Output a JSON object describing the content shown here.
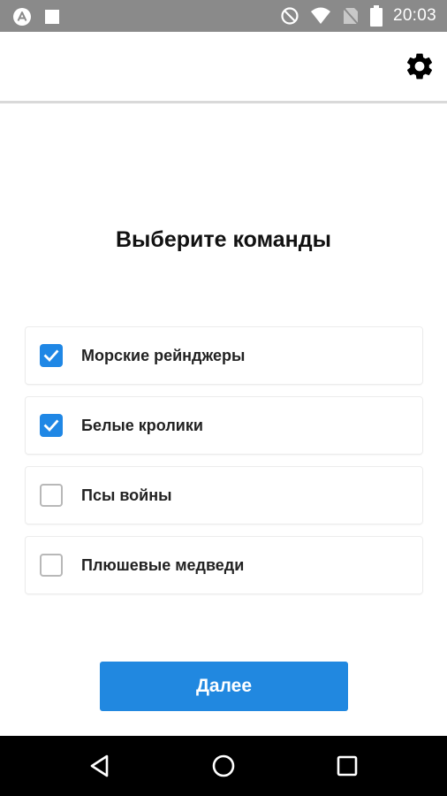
{
  "status_bar": {
    "time": "20:03",
    "icons": [
      "app-notification-icon",
      "square-notification-icon",
      "do-not-disturb-icon",
      "wifi-icon",
      "no-sim-icon",
      "battery-icon"
    ]
  },
  "app_bar": {
    "settings_icon": "gear-icon"
  },
  "main": {
    "title": "Выберите команды",
    "teams": [
      {
        "label": "Морские рейнджеры",
        "checked": true
      },
      {
        "label": "Белые кролики",
        "checked": true
      },
      {
        "label": "Псы войны",
        "checked": false
      },
      {
        "label": "Плюшевые медведи",
        "checked": false
      }
    ],
    "next_label": "Далее"
  },
  "nav_bar": {
    "icons": [
      "back-icon",
      "home-icon",
      "recents-icon"
    ]
  },
  "colors": {
    "accent": "#1f87e5",
    "button": "#2188e0",
    "status_bar": "#8a8a8a"
  }
}
